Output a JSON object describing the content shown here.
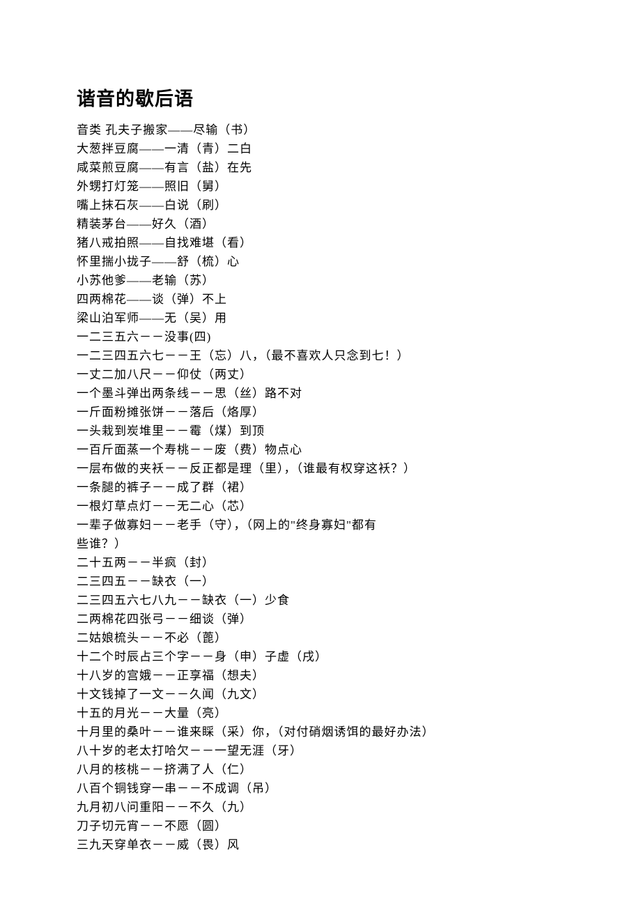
{
  "title": "谐音的歇后语",
  "lines": [
    "音类 孔夫子搬家——尽输（书）",
    "大葱拌豆腐——一清（青）二白",
    "咸菜煎豆腐——有言（盐）在先",
    "外甥打灯笼——照旧（舅）",
    "嘴上抹石灰——白说（刷）",
    "精装茅台——好久（酒）",
    "猪八戒拍照——自找难堪（看）",
    "怀里揣小拢子——舒（梳）心",
    "小苏他爹——老输（苏）",
    "四两棉花——谈（弹）不上",
    "梁山泊军师——无（吴）用",
    "一二三五六－－没事(四)",
    "一二三四五六七－－王（忘）八，（最不喜欢人只念到七！）",
    "一丈二加八尺－－仰仗（两丈）",
    "一个墨斗弹出两条线－－思（丝）路不对",
    "一斤面粉摊张饼－－落后（烙厚）",
    "一头栽到炭堆里－－霉（煤）到顶",
    "一百斤面蒸一个寿桃－－废（费）物点心",
    "一层布做的夹袄－－反正都是理（里），（谁最有权穿这袄？）",
    "一条腿的裤子－－成了群（裙）",
    "一根灯草点灯－－无二心（芯）",
    "一辈子做寡妇－－老手（守），（网上的\"终身寡妇\"都有",
    "些谁？）",
    "二十五两－－半疯（封）",
    "二三四五－－缺衣（一）",
    "二三四五六七八九－－缺衣（一）少食",
    "二两棉花四张弓－－细谈（弹）",
    "二姑娘梳头－－不必（蓖）",
    "十二个时辰占三个字－－身（申）子虚（戌）",
    "十八岁的宫娥－－正享福（想夫）",
    "十文钱掉了一文－－久闻（九文）",
    "十五的月光－－大量（亮）",
    "十月里的桑叶－－谁来睬（采）你，（对付硝烟诱饵的最好办法）",
    "八十岁的老太打哈欠－－一望无涯（牙）",
    "八月的核桃－－挤满了人（仁）",
    "八百个铜钱穿一串－－不成调（吊）",
    "九月初八问重阳－－不久（九）",
    "刀子切元宵－－不愿（圆）",
    "三九天穿单衣－－威（畏）风"
  ]
}
